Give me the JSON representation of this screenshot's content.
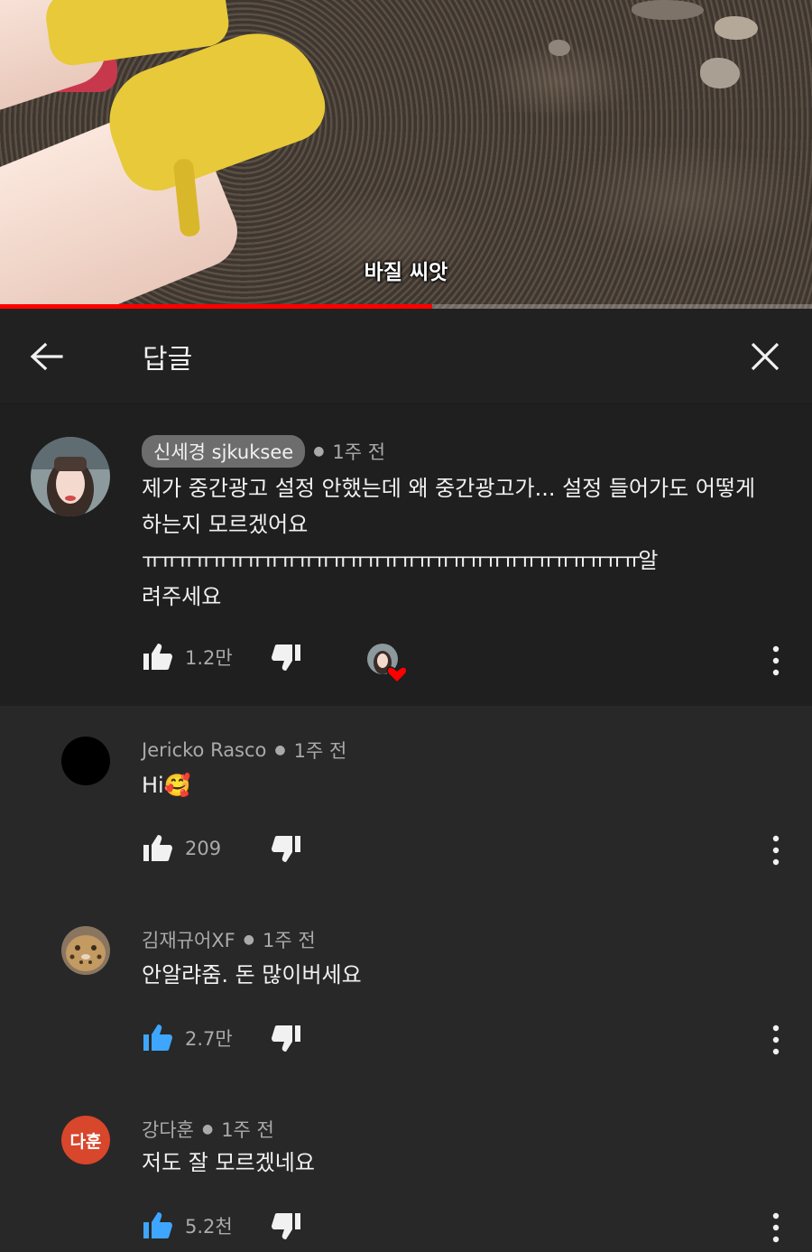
{
  "video": {
    "subtitle": "바질 씨앗",
    "progress_fraction": 0.532
  },
  "header": {
    "title": "답글",
    "back_icon": "arrow-left-icon",
    "close_icon": "close-icon"
  },
  "main_comment": {
    "author": "신세경 sjkuksee",
    "time": "1주 전",
    "text_lines": [
      "제가 중간광고 설정 안했는데 왜 중간광고가... 설정 들어가도 어떻게",
      "하는지 모르겠어요",
      "ㅠㅠㅠㅠㅠㅠㅠㅠㅠㅠㅠㅠㅠㅠㅠㅠㅠㅠㅠㅠㅠㅠㅠㅠㅠㅠㅠㅠㅠ알",
      "려주세요"
    ],
    "likes": "1.2만",
    "creator_heart": true
  },
  "replies": [
    {
      "author": "Jericko Rasco",
      "time": "1주 전",
      "text": "Hi🥰",
      "likes": "209",
      "avatar_color": "#000000"
    },
    {
      "author": "김재규어XF",
      "time": "1주 전",
      "text": "안알랴줌. 돈 많이버세요",
      "likes": "2.7만",
      "liked": true
    },
    {
      "author": "강다훈",
      "time": "1주 전",
      "text": "저도 잘 모르겠네요",
      "likes": "5.2천",
      "liked": true,
      "avatar_text": "다훈",
      "avatar_color": "#d8462b"
    }
  ],
  "colors": {
    "accent_blue": "#3ea6ff",
    "progress_red": "#ff0000",
    "heart_red": "#ff0000"
  }
}
